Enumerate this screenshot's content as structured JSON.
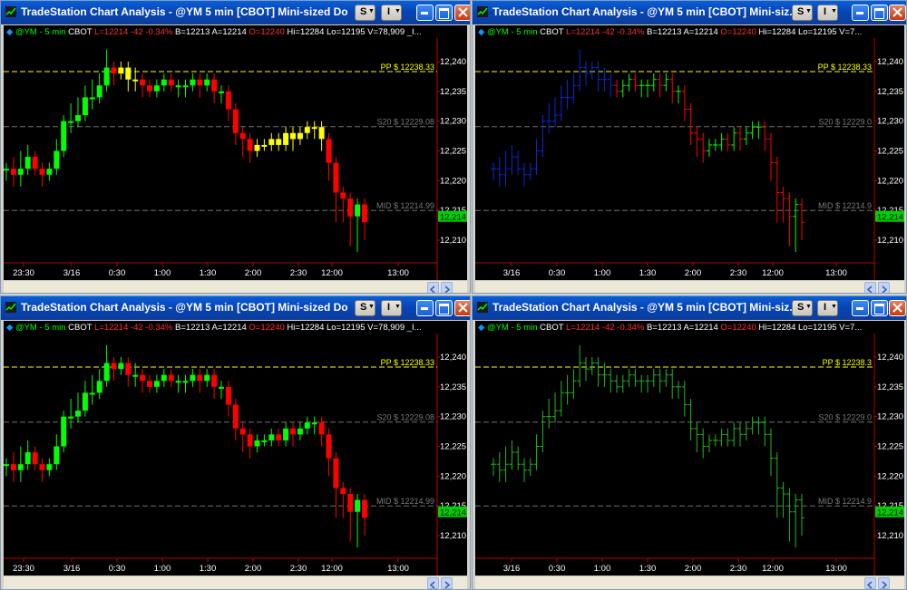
{
  "theme": {
    "candle_up": "#00ff00",
    "candle_down": "#ff0000",
    "neutral": "#ffff00",
    "blue": "#0a2ad8",
    "bar_green": "#22b81c",
    "pp_color": "#ffff00",
    "line_color": "#707070",
    "price_box_bg": "#00d000"
  },
  "windows": [
    {
      "title": "TradeStation Chart Analysis - @YM  5 min  [CBOT] Mini-sized Dow ...",
      "status": {
        "symbol": "@YM - 5 min",
        "exchange": "CBOT",
        "last": "L=12214",
        "change": "-42",
        "pct": "-0.34%",
        "bid": "B=12213",
        "ask": "A=12214",
        "open": "O=12240",
        "high": "Hi=12284",
        "low": "Lo=12195",
        "volume": "V=78,909",
        "extra": "_I..."
      },
      "style": "candle-neutral",
      "time_labels": [
        "23:30",
        "3/16",
        "0:30",
        "1:00",
        "1:30",
        "2:00",
        "2:30",
        "12:00",
        "13:00"
      ],
      "price_labels": [
        "12,240",
        "12,235",
        "12,230",
        "12,225",
        "12,220",
        "12,215",
        "12,210"
      ],
      "last_price": "12,214",
      "levels": {
        "pp": "PP $ 12238.33",
        "s20": "S20 $ 12229.08",
        "mid": "MID $ 12214.99"
      }
    },
    {
      "title": "TradeStation Chart Analysis - @YM  5 min  [CBOT] Mini-siz...",
      "status": {
        "symbol": "@YM - 5 min",
        "exchange": "CBOT",
        "last": "L=12214",
        "change": "-42",
        "pct": "-0.34%",
        "bid": "B=12213",
        "ask": "A=12214",
        "open": "O=12240",
        "high": "Hi=12284",
        "low": "Lo=12195",
        "volume": "V=7...",
        "extra": ""
      },
      "style": "bar-bluered",
      "time_labels": [
        "3/16",
        "0:30",
        "1:00",
        "1:30",
        "2:00",
        "2:30",
        "12:00",
        "13:00"
      ],
      "price_labels": [
        "12,240",
        "12,235",
        "12,230",
        "12,225",
        "12,220",
        "12,215",
        "12,210"
      ],
      "last_price": "12,214",
      "levels": {
        "pp": "PP $ 12238.33",
        "s20": "S20 $ 12229.0",
        "mid": "MID $ 12214.9"
      }
    },
    {
      "title": "TradeStation Chart Analysis - @YM  5 min  [CBOT] Mini-sized Dow ...",
      "status": {
        "symbol": "@YM - 5 min",
        "exchange": "CBOT",
        "last": "L=12214",
        "change": "-42",
        "pct": "-0.34%",
        "bid": "B=12213",
        "ask": "A=12214",
        "open": "O=12240",
        "high": "Hi=12284",
        "low": "Lo=12195",
        "volume": "V=78,909",
        "extra": "_I..."
      },
      "style": "candle",
      "time_labels": [
        "23:30",
        "3/16",
        "0:30",
        "1:00",
        "1:30",
        "2:00",
        "2:30",
        "12:00",
        "13:00"
      ],
      "price_labels": [
        "12,240",
        "12,235",
        "12,230",
        "12,225",
        "12,220",
        "12,215",
        "12,210"
      ],
      "last_price": "12,214",
      "levels": {
        "pp": "PP $ 12238.33",
        "s20": "S20 $ 12229.08",
        "mid": "MID $ 12214.99"
      }
    },
    {
      "title": "TradeStation Chart Analysis - @YM  5 min  [CBOT] Mini-siz...",
      "status": {
        "symbol": "@YM - 5 min",
        "exchange": "CBOT",
        "last": "L=12214",
        "change": "-42",
        "pct": "-0.34%",
        "bid": "B=12213",
        "ask": "A=12214",
        "open": "O=12240",
        "high": "Hi=12284",
        "low": "Lo=12195",
        "volume": "V=7...",
        "extra": ""
      },
      "style": "bar-green",
      "time_labels": [
        "3/16",
        "0:30",
        "1:00",
        "1:30",
        "2:00",
        "2:30",
        "12:00",
        "13:00"
      ],
      "price_labels": [
        "12,240",
        "12,235",
        "12,230",
        "12,225",
        "12,220",
        "12,215",
        "12,210"
      ],
      "last_price": "12,214",
      "levels": {
        "pp": "PP $ 12238.3",
        "s20": "S20 $ 12229.0",
        "mid": "MID $ 12214.9"
      }
    }
  ],
  "toolbar": {
    "s_label": "S",
    "i_label": "I"
  },
  "price_series": {
    "opens": [
      12222,
      12222,
      12221,
      12222,
      12224,
      12222,
      12221,
      12222,
      12225,
      12230,
      12230,
      12231,
      12234,
      12234,
      12236,
      12239,
      12238,
      12239,
      12237,
      12237,
      12236,
      12235,
      12236,
      12237,
      12236,
      12236,
      12236,
      12237,
      12236,
      12237,
      12235,
      12235,
      12232,
      12228,
      12227,
      12225,
      12226,
      12226,
      12227,
      12226,
      12228,
      12227,
      12228,
      12229,
      12229,
      12227,
      12223,
      12218,
      12217,
      12214,
      12216
    ],
    "closes": [
      12222,
      12221,
      12222,
      12224,
      12222,
      12221,
      12222,
      12225,
      12230,
      12230,
      12231,
      12234,
      12234,
      12236,
      12239,
      12238,
      12239,
      12237,
      12237,
      12236,
      12235,
      12236,
      12237,
      12236,
      12236,
      12236,
      12237,
      12236,
      12237,
      12235,
      12235,
      12232,
      12228,
      12227,
      12225,
      12226,
      12226,
      12227,
      12226,
      12228,
      12227,
      12228,
      12229,
      12229,
      12227,
      12223,
      12218,
      12217,
      12214,
      12216,
      12213
    ],
    "highs": [
      12223,
      12224,
      12225,
      12226,
      12225,
      12223,
      12223,
      12227,
      12231,
      12233,
      12234,
      12236,
      12237,
      12238,
      12242,
      12240,
      12240,
      12240,
      12239,
      12238,
      12237,
      12237,
      12238,
      12238,
      12237,
      12237,
      12238,
      12238,
      12238,
      12238,
      12236,
      12236,
      12233,
      12229,
      12228,
      12227,
      12227,
      12228,
      12228,
      12229,
      12229,
      12229,
      12230,
      12230,
      12230,
      12228,
      12224,
      12219,
      12218,
      12217,
      12217
    ],
    "lows": [
      12220,
      12219,
      12219,
      12221,
      12221,
      12219,
      12220,
      12221,
      12224,
      12228,
      12229,
      12230,
      12232,
      12233,
      12235,
      12236,
      12237,
      12235,
      12235,
      12234,
      12234,
      12234,
      12235,
      12235,
      12234,
      12234,
      12235,
      12234,
      12235,
      12233,
      12233,
      12230,
      12226,
      12224,
      12223,
      12224,
      12225,
      12225,
      12225,
      12225,
      12225,
      12226,
      12227,
      12227,
      12225,
      12220,
      12213,
      12213,
      12209,
      12208,
      12210
    ]
  }
}
